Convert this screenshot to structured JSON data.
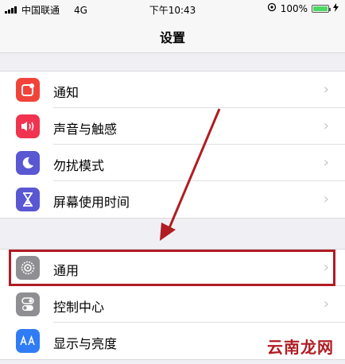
{
  "status_bar": {
    "carrier": "中国联通",
    "network": "4G",
    "time": "下午10:43",
    "battery_percent": "100%"
  },
  "nav": {
    "title": "设置"
  },
  "group1": [
    {
      "label": "通知",
      "icon": "notifications-icon",
      "color": "#f0443a"
    },
    {
      "label": "声音与触感",
      "icon": "sounds-icon",
      "color": "#f0344f"
    },
    {
      "label": "勿扰模式",
      "icon": "do-not-disturb-icon",
      "color": "#5a57d3"
    },
    {
      "label": "屏幕使用时间",
      "icon": "screen-time-icon",
      "color": "#5a57d3"
    }
  ],
  "group2": [
    {
      "label": "通用",
      "icon": "general-icon",
      "color": "#8e8e93"
    },
    {
      "label": "控制中心",
      "icon": "control-center-icon",
      "color": "#8e8e93"
    },
    {
      "label": "显示与亮度",
      "icon": "display-brightness-icon",
      "color": "#2f7cf6"
    }
  ],
  "watermark": "云南龙网",
  "colors": {
    "annotation": "#b01c23"
  }
}
